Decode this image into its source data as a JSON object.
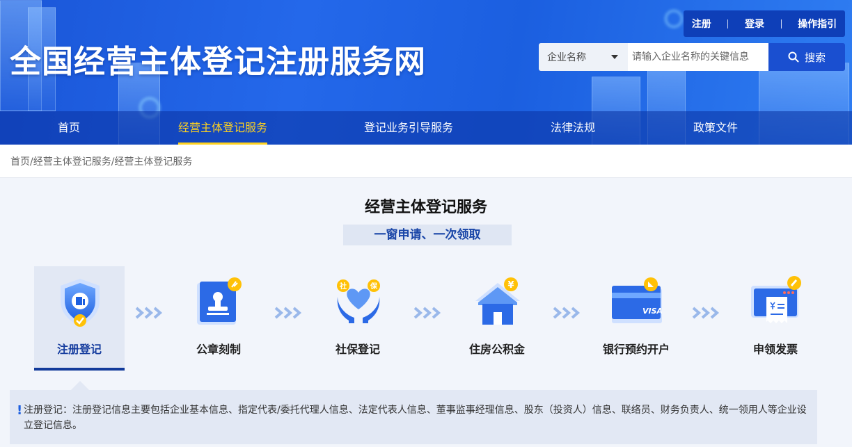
{
  "header": {
    "site_title": "全国经营主体登记注册服务网",
    "top_links": [
      "注册",
      "登录",
      "操作指引"
    ],
    "search": {
      "select_value": "企业名称",
      "placeholder": "请输入企业名称的关键信息",
      "button_label": "搜索"
    }
  },
  "nav": {
    "items": [
      {
        "label": "首页"
      },
      {
        "label": "经营主体登记服务"
      },
      {
        "label": "登记业务引导服务"
      },
      {
        "label": "法律法规"
      },
      {
        "label": "政策文件"
      }
    ],
    "active": "经营主体登记服务"
  },
  "breadcrumb": "首页/经营主体登记服务/经营主体登记服务",
  "main": {
    "title": "经营主体登记服务",
    "slogan": "一窗申请、一次领取",
    "steps": [
      {
        "label": "注册登记",
        "icon": "shield-check-icon"
      },
      {
        "label": "公章刻制",
        "icon": "stamp-icon"
      },
      {
        "label": "社保登记",
        "icon": "heart-hands-icon",
        "badges": [
          "社",
          "保"
        ]
      },
      {
        "label": "住房公积金",
        "icon": "house-icon",
        "badge": "¥"
      },
      {
        "label": "银行预约开户",
        "icon": "bank-card-icon",
        "card_text": "VISA"
      },
      {
        "label": "申领发票",
        "icon": "invoice-icon"
      }
    ],
    "active_step": "注册登记",
    "description": "注册登记：注册登记信息主要包括企业基本信息、指定代表/委托代理人信息、法定代表人信息、董事监事经理信息、股东（投资人）信息、联络员、财务负责人、统一领用人等企业设立登记信息。"
  },
  "colors": {
    "primary": "#1a4fd0",
    "nav_active": "#ffd21f",
    "accent_badge": "#ffc107",
    "panel_bg": "#e2e8f4"
  }
}
